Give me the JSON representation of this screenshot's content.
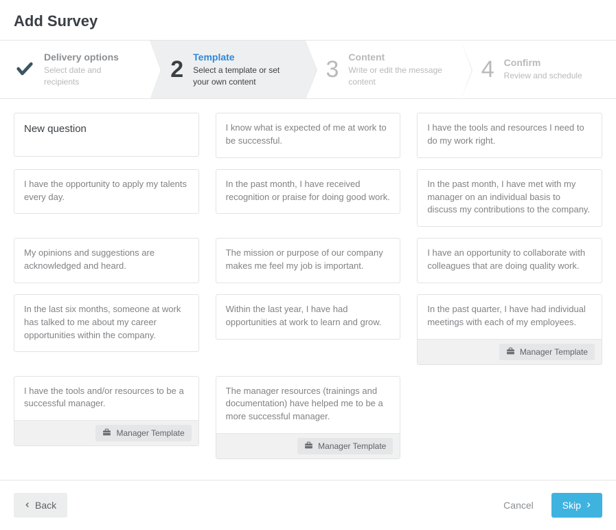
{
  "page": {
    "title": "Add Survey"
  },
  "stepper": {
    "steps": [
      {
        "title": "Delivery options",
        "sub": "Select date and recipients",
        "state": "done"
      },
      {
        "number": "2",
        "title": "Template",
        "sub": "Select a template or set your own content",
        "state": "active"
      },
      {
        "number": "3",
        "title": "Content",
        "sub": "Write or edit the message content",
        "state": "future"
      },
      {
        "number": "4",
        "title": "Confirm",
        "sub": "Review and schedule",
        "state": "future"
      }
    ]
  },
  "template_tag_label": "Manager Template",
  "cards": [
    {
      "text": "New question",
      "is_new": true,
      "tagged": false
    },
    {
      "text": "I know what is expected of me at work to be successful.",
      "tagged": false
    },
    {
      "text": "I have the tools and resources I need to do my work right.",
      "tagged": false
    },
    {
      "text": "I have the opportunity to apply my talents every day.",
      "tagged": false
    },
    {
      "text": "In the past month, I have received recognition or praise for doing good work.",
      "tagged": false
    },
    {
      "text": "In the past month, I have met with my manager on an individual basis to discuss my contributions to the company.",
      "tagged": false
    },
    {
      "text": "My opinions and suggestions are acknowledged and heard.",
      "tagged": false
    },
    {
      "text": "The mission or purpose of our company makes me feel my job is important.",
      "tagged": false
    },
    {
      "text": "I have an opportunity to collaborate with colleagues that are doing quality work.",
      "tagged": false
    },
    {
      "text": "In the last six months, someone at work has talked to me about my career opportunities within the company.",
      "tagged": false
    },
    {
      "text": "Within the last year, I have had opportunities at work to learn and grow.",
      "tagged": false
    },
    {
      "text": "In the past quarter, I have had individual meetings with each of my employees.",
      "tagged": true
    },
    {
      "text": "I have the tools and/or resources to be a successful manager.",
      "tagged": true
    },
    {
      "text": "The manager resources (trainings and documentation) have helped me to be a more successful manager.",
      "tagged": true
    }
  ],
  "footer": {
    "back": "Back",
    "cancel": "Cancel",
    "skip": "Skip"
  }
}
